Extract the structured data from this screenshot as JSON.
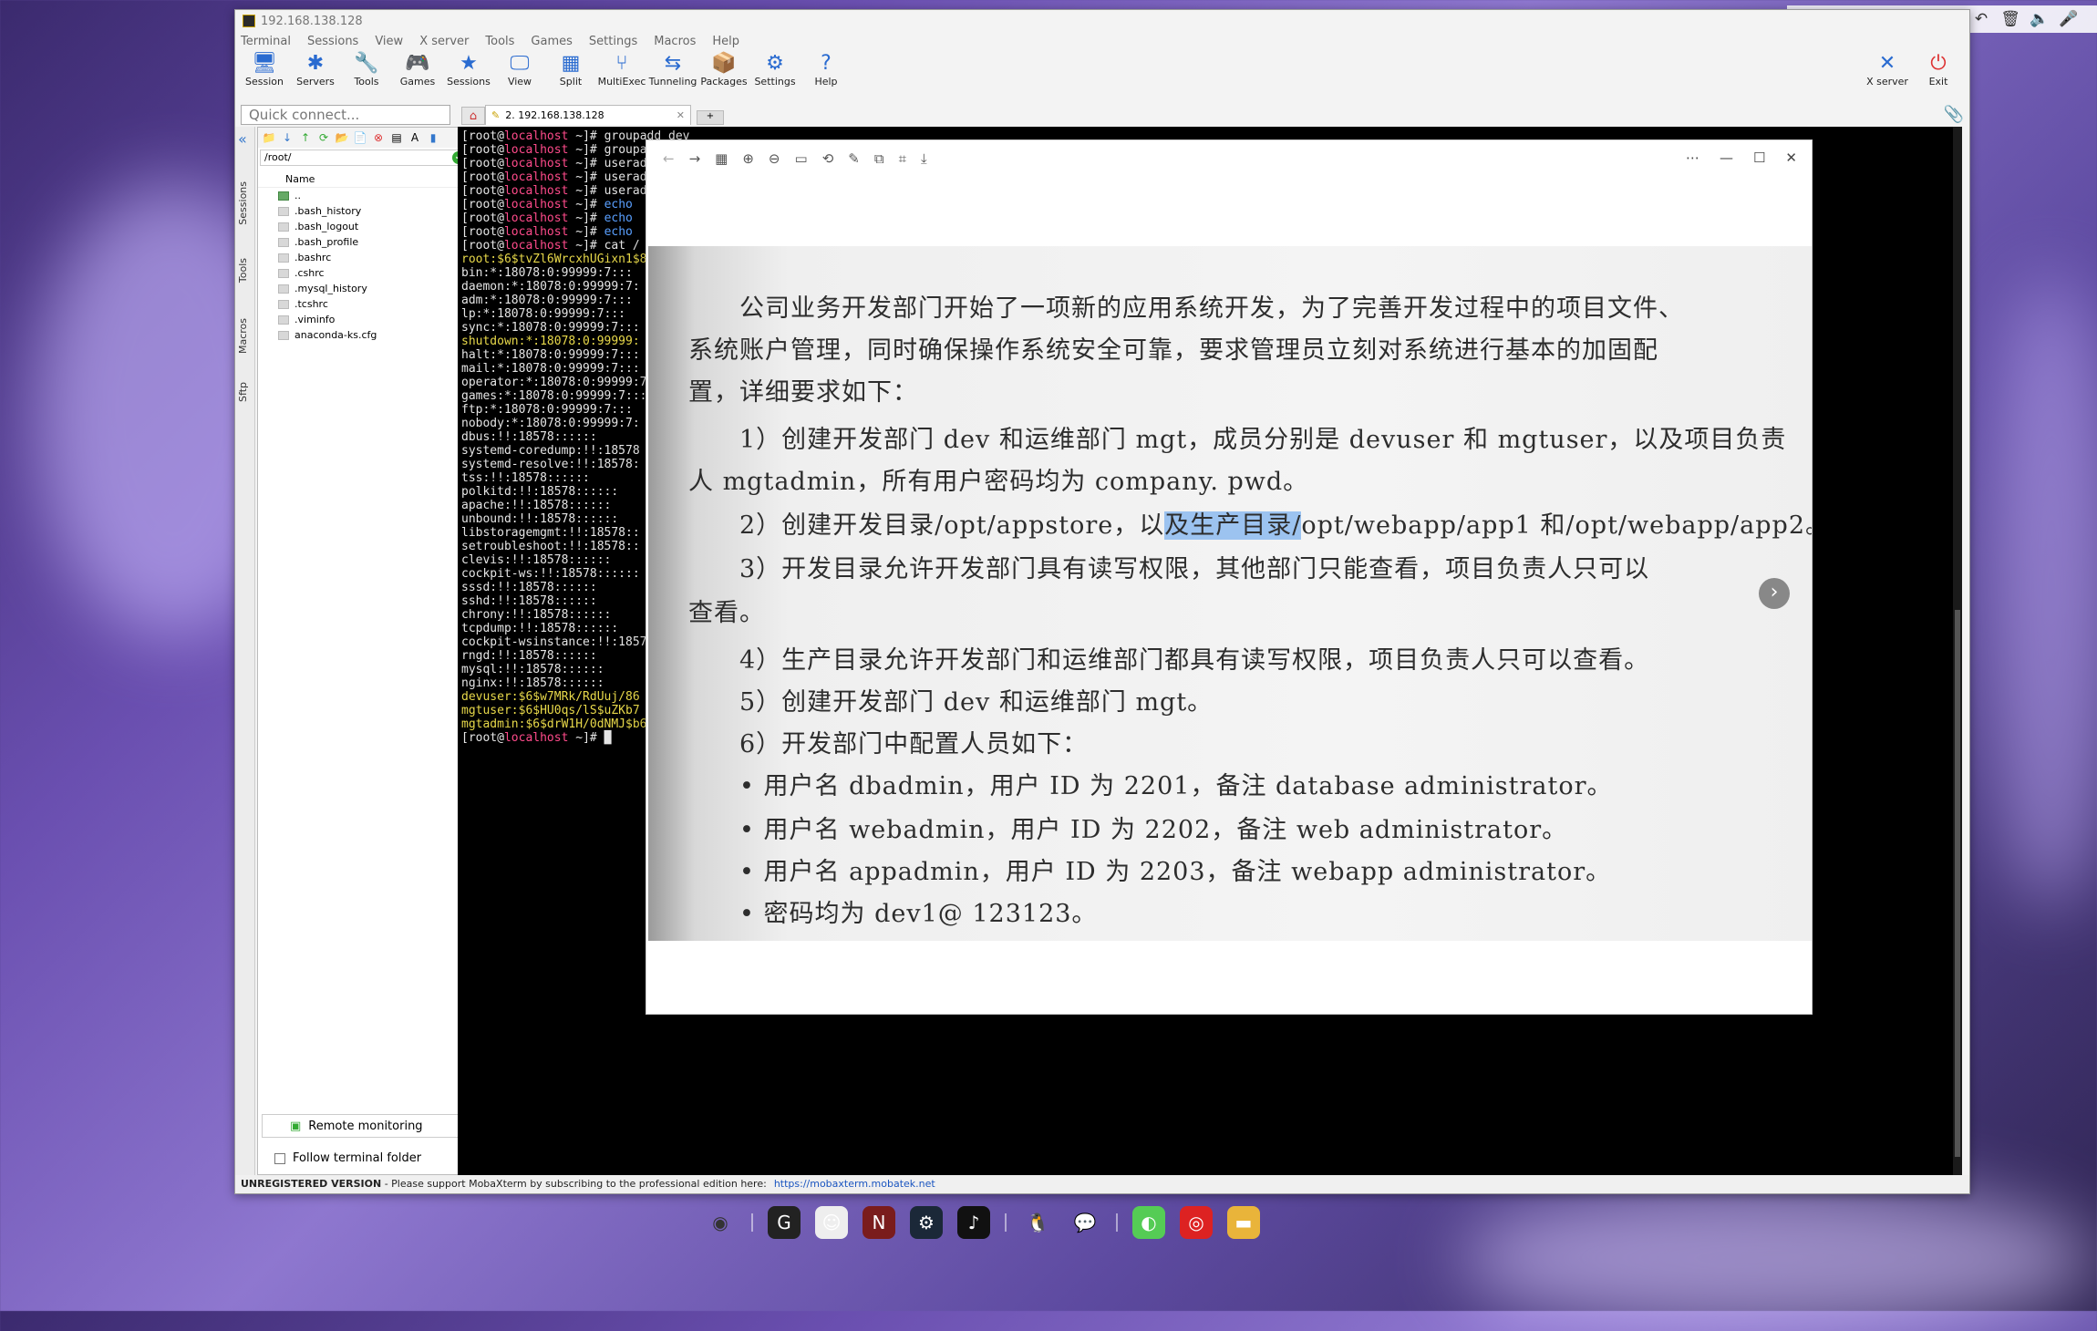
{
  "window": {
    "title": "192.168.138.128"
  },
  "menu": [
    "Terminal",
    "Sessions",
    "View",
    "X server",
    "Tools",
    "Games",
    "Settings",
    "Macros",
    "Help"
  ],
  "toolbar": [
    {
      "label": "Session",
      "icon": "session-icon",
      "glyph": "🖥"
    },
    {
      "label": "Servers",
      "icon": "servers-icon",
      "glyph": "✱"
    },
    {
      "label": "Tools",
      "icon": "tools-icon",
      "glyph": "🔧"
    },
    {
      "label": "Games",
      "icon": "games-icon",
      "glyph": "🎮"
    },
    {
      "label": "Sessions",
      "icon": "star-icon",
      "glyph": "★"
    },
    {
      "label": "View",
      "icon": "view-icon",
      "glyph": "🖵"
    },
    {
      "label": "Split",
      "icon": "split-icon",
      "glyph": "▦"
    },
    {
      "label": "MultiExec",
      "icon": "multiexec-icon",
      "glyph": "⑂"
    },
    {
      "label": "Tunneling",
      "icon": "tunneling-icon",
      "glyph": "⇆"
    },
    {
      "label": "Packages",
      "icon": "packages-icon",
      "glyph": "📦"
    },
    {
      "label": "Settings",
      "icon": "settings-icon",
      "glyph": "⚙"
    },
    {
      "label": "Help",
      "icon": "help-icon",
      "glyph": "?"
    }
  ],
  "toolbar_right": [
    {
      "label": "X server",
      "glyph": "✕"
    },
    {
      "label": "Exit",
      "glyph": "⏻"
    }
  ],
  "quick_connect": {
    "placeholder": "Quick connect..."
  },
  "tabs": {
    "active": "2. 192.168.138.128"
  },
  "sidebar_tabs": [
    "Sessions",
    "Tools",
    "Macros",
    "Sftp"
  ],
  "files": {
    "path": "/root/",
    "header": "Name",
    "items": [
      "..",
      ".bash_history",
      ".bash_logout",
      ".bash_profile",
      ".bashrc",
      ".cshrc",
      ".mysql_history",
      ".tcshrc",
      ".viminfo",
      "anaconda-ks.cfg"
    ],
    "remote_monitoring": "Remote monitoring",
    "follow_folder": "Follow terminal folder"
  },
  "terminal": {
    "prompt_user": "[root@",
    "prompt_host": "localhost",
    "prompt_tail": " ~]# ",
    "lines": [
      {
        "p": true,
        "t": "groupadd dev"
      },
      {
        "p": true,
        "t": "groupa"
      },
      {
        "p": true,
        "t": "userad"
      },
      {
        "p": true,
        "t": "userad"
      },
      {
        "p": true,
        "t": "userad"
      },
      {
        "p": true,
        "t": "echo ",
        "c": "cmd"
      },
      {
        "p": true,
        "t": "echo ",
        "c": "cmd"
      },
      {
        "p": true,
        "t": "echo ",
        "c": "cmd"
      },
      {
        "p": true,
        "t": "cat /"
      },
      {
        "t": "root:$6$tvZl6WrcxhUGixn1$8"
      },
      {
        "t": "bin:*:18078:0:99999:7:::"
      },
      {
        "t": "daemon:*:18078:0:99999:7:"
      },
      {
        "t": "adm:*:18078:0:99999:7:::"
      },
      {
        "t": "lp:*:18078:0:99999:7:::"
      },
      {
        "t": "sync:*:18078:0:99999:7:::"
      },
      {
        "t": "shutdown:*:18078:0:99999:"
      },
      {
        "t": "halt:*:18078:0:99999:7:::"
      },
      {
        "t": "mail:*:18078:0:99999:7:::"
      },
      {
        "t": "operator:*:18078:0:99999:7"
      },
      {
        "t": "games:*:18078:0:99999:7:::"
      },
      {
        "t": "ftp:*:18078:0:99999:7:::"
      },
      {
        "t": "nobody:*:18078:0:99999:7:"
      },
      {
        "t": "dbus:!!:18578::::::"
      },
      {
        "t": "systemd-coredump:!!:18578"
      },
      {
        "t": "systemd-resolve:!!:18578:"
      },
      {
        "t": "tss:!!:18578::::::"
      },
      {
        "t": "polkitd:!!:18578::::::"
      },
      {
        "t": "apache:!!:18578::::::"
      },
      {
        "t": "unbound:!!:18578::::::"
      },
      {
        "t": "libstoragemgmt:!!:18578::"
      },
      {
        "t": "setroubleshoot:!!:18578::"
      },
      {
        "t": "clevis:!!:18578::::::"
      },
      {
        "t": "cockpit-ws:!!:18578::::::"
      },
      {
        "t": "sssd:!!:18578::::::"
      },
      {
        "t": "sshd:!!:18578::::::"
      },
      {
        "t": "chrony:!!:18578::::::"
      },
      {
        "t": "tcpdump:!!:18578::::::"
      },
      {
        "t": "cockpit-wsinstance:!!:1857"
      },
      {
        "t": "rngd:!!:18578::::::"
      },
      {
        "t": "mysql:!!:18578::::::"
      },
      {
        "t": "nginx:!!:18578::::::"
      },
      {
        "t": "devuser:$6$w7MRk/RdUuj/86"
      },
      {
        "t": "mgtuser:$6$HU0qs/lS$uZKb7"
      },
      {
        "t": "mgtadmin:$6$drW1H/0dNMJ$b6"
      },
      {
        "p": true,
        "t": "█"
      }
    ]
  },
  "status": {
    "bold": "UNREGISTERED VERSION",
    "text": " -  Please support MobaXterm by subscribing to the professional edition here:",
    "link": "https://mobaxterm.mobatek.net"
  },
  "viewer": {
    "lines": [
      "公司业务开发部门开始了一项新的应用系统开发，为了完善开发过程中的项目文件、",
      "系统账户管理，同时确保操作系统安全可靠，要求管理员立刻对系统进行基本的加固配",
      "置，详细要求如下：",
      "1）创建开发部门 dev 和运维部门 mgt，成员分别是 devuser 和 mgtuser，以及项目负责",
      "人 mgtadmin，所有用户密码均为 company. pwd。",
      "2）创建开发目录/opt/appstore，以",
      "及生产目录/",
      "opt/webapp/app1 和/opt/webapp/app2。",
      "3）开发目录允许开发部门具有读写权限，其他部门只能查看，项目负责人只可以",
      "查看。",
      "4）生产目录允许开发部门和运维部门都具有读写权限，项目负责人只可以查看。",
      "5）创建开发部门 dev 和运维部门 mgt。",
      "6）开发部门中配置人员如下：",
      "• 用户名 dbadmin，用户 ID 为 2201，备注 database administrator。",
      "• 用户名 webadmin，用户 ID 为 2202，备注 web administrator。",
      "• 用户名 appadmin，用户 ID 为 2203，备注 webapp administrator。",
      "• 密码均为 dev1@ 123123。"
    ]
  },
  "taskbar": [
    "chrome-icon",
    "app-icon",
    "game-icon",
    "naraka-icon",
    "steam-icon",
    "tiktok-icon",
    "qq-icon",
    "wechat-icon",
    "green-app-icon",
    "netease-music-icon",
    "folder-icon"
  ]
}
